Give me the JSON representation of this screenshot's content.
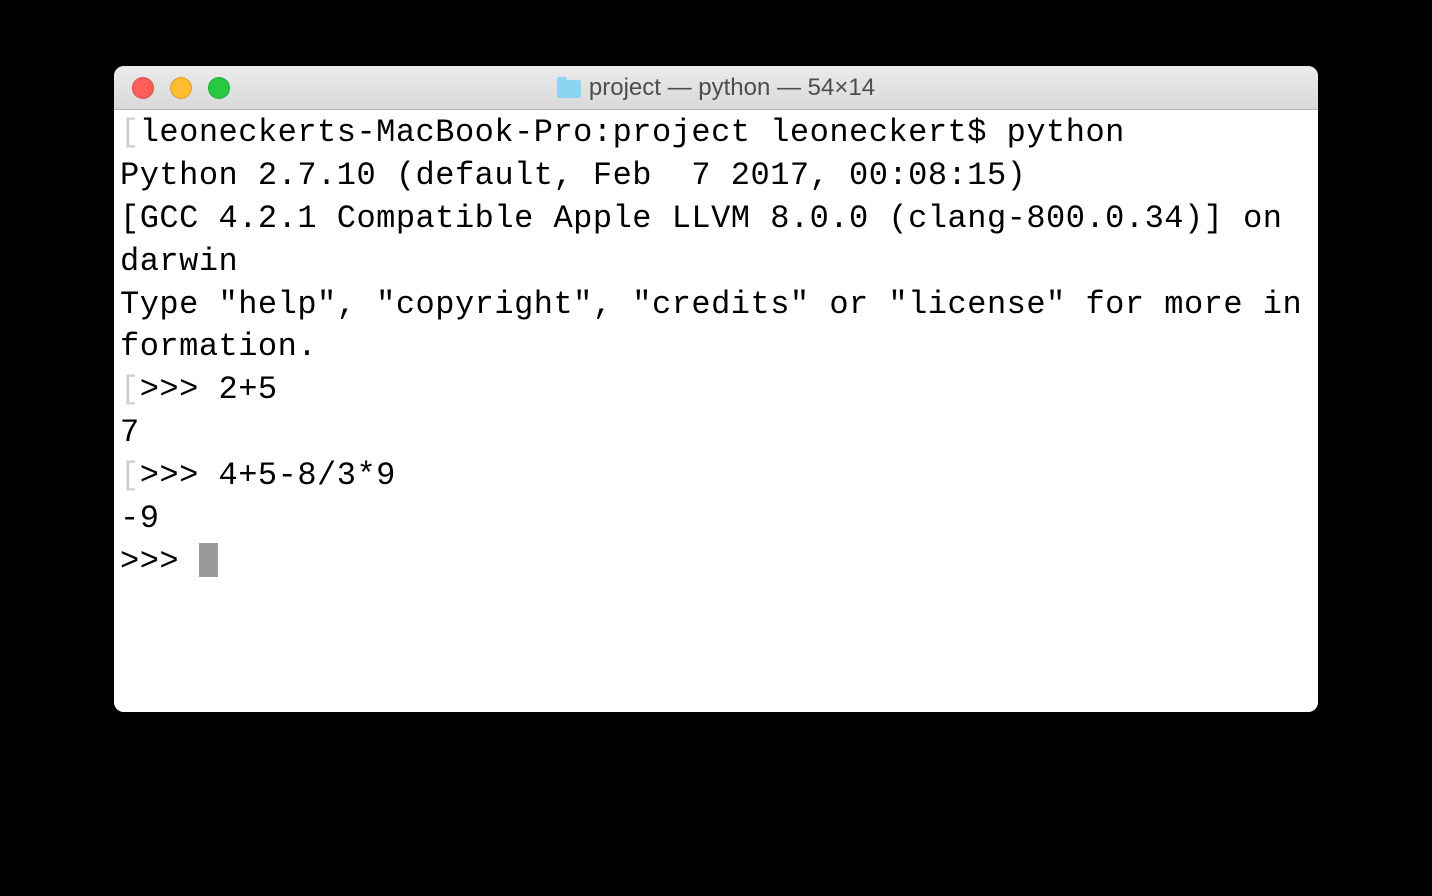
{
  "window": {
    "title": "project — python — 54×14"
  },
  "terminal": {
    "shell_prompt": "leoneckerts-MacBook-Pro:project leoneckert$ python",
    "banner_line1": "Python 2.7.10 (default, Feb  7 2017, 00:08:15) ",
    "banner_line2": "[GCC 4.2.1 Compatible Apple LLVM 8.0.0 (clang-800.0.34)] on darwin",
    "banner_line3": "Type \"help\", \"copyright\", \"credits\" or \"license\" for more information.",
    "repl": [
      {
        "prompt": ">>> ",
        "input": "2+5",
        "output": "7"
      },
      {
        "prompt": ">>> ",
        "input": "4+5-8/3*9",
        "output": "-9"
      }
    ],
    "current_prompt": ">>> "
  }
}
